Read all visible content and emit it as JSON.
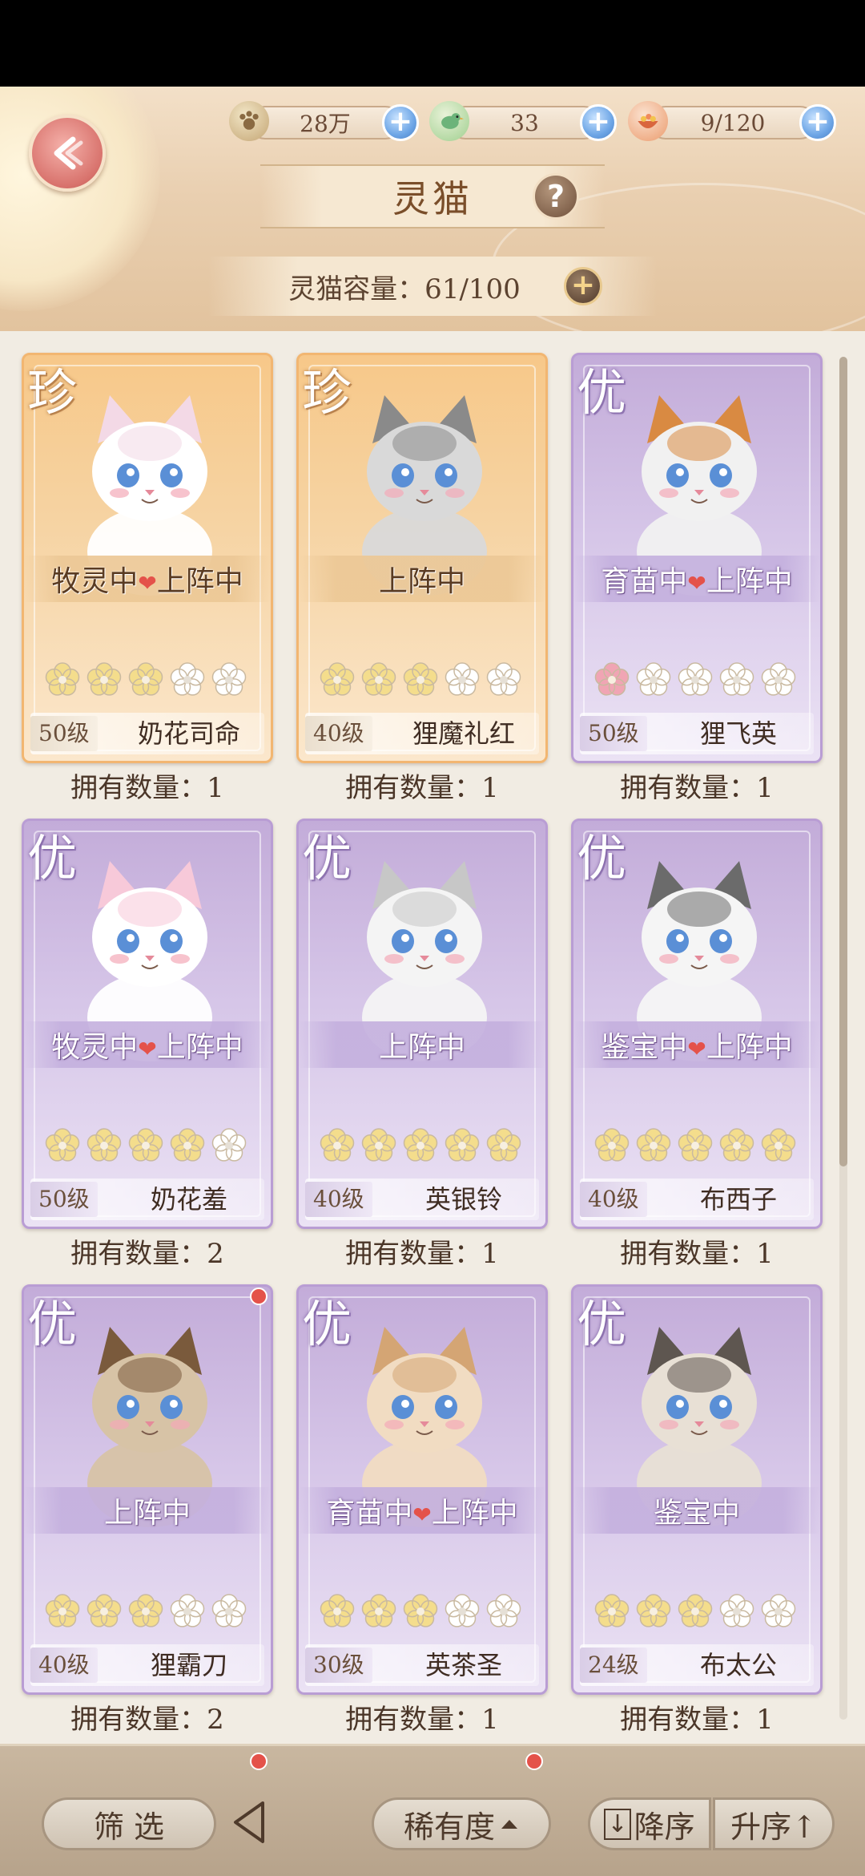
{
  "currencies": [
    {
      "icon": "paw-coin-icon",
      "value": "28万"
    },
    {
      "icon": "bird-icon",
      "value": "33"
    },
    {
      "icon": "food-bowl-icon",
      "value": "9/120"
    }
  ],
  "title": "灵猫",
  "capacity": "灵猫容量：61/100",
  "cards": [
    {
      "rarity": "珍",
      "theme": "gold",
      "status": "牧灵中❤上阵中",
      "level": "50级",
      "name": "奶花司命",
      "stars": 3,
      "star_style": "gold",
      "owned": "拥有数量：1"
    },
    {
      "rarity": "珍",
      "theme": "gold",
      "status": "上阵中",
      "level": "40级",
      "name": "狸魔礼红",
      "stars": 3,
      "star_style": "gold",
      "owned": "拥有数量：1"
    },
    {
      "rarity": "优",
      "theme": "purple",
      "status": "育苗中❤上阵中",
      "level": "50级",
      "name": "狸飞英",
      "stars": 1,
      "star_style": "pink",
      "owned": "拥有数量：1"
    },
    {
      "rarity": "优",
      "theme": "purple",
      "status": "牧灵中❤上阵中",
      "level": "50级",
      "name": "奶花羞",
      "stars": 4,
      "star_style": "gold",
      "owned": "拥有数量：2"
    },
    {
      "rarity": "优",
      "theme": "purple",
      "status": "上阵中",
      "level": "40级",
      "name": "英银铃",
      "stars": 5,
      "star_style": "gold",
      "owned": "拥有数量：1"
    },
    {
      "rarity": "优",
      "theme": "purple",
      "status": "鉴宝中❤上阵中",
      "level": "40级",
      "name": "布西子",
      "stars": 5,
      "star_style": "gold",
      "owned": "拥有数量：1"
    },
    {
      "rarity": "优",
      "theme": "purple",
      "status": "上阵中",
      "level": "40级",
      "name": "狸霸刀",
      "stars": 3,
      "star_style": "gold",
      "owned": "拥有数量：2",
      "badge": true
    },
    {
      "rarity": "优",
      "theme": "purple",
      "status": "育苗中❤上阵中",
      "level": "30级",
      "name": "英茶圣",
      "stars": 3,
      "star_style": "gold",
      "owned": "拥有数量：1"
    },
    {
      "rarity": "优",
      "theme": "purple",
      "status": "鉴宝中",
      "level": "24级",
      "name": "布太公",
      "stars": 3,
      "star_style": "gold",
      "owned": "拥有数量：1"
    }
  ],
  "bottom": {
    "filter_label": "筛 选",
    "sort_field_label": "稀有度",
    "descending_label": "降序",
    "ascending_label": "升序↑"
  },
  "colors": {
    "gold_card": "#f7c889",
    "purple_card": "#c3acd9",
    "star_gold": "#f4dd8c",
    "star_pink": "#f0a5b4",
    "star_empty": "#ffffff"
  }
}
